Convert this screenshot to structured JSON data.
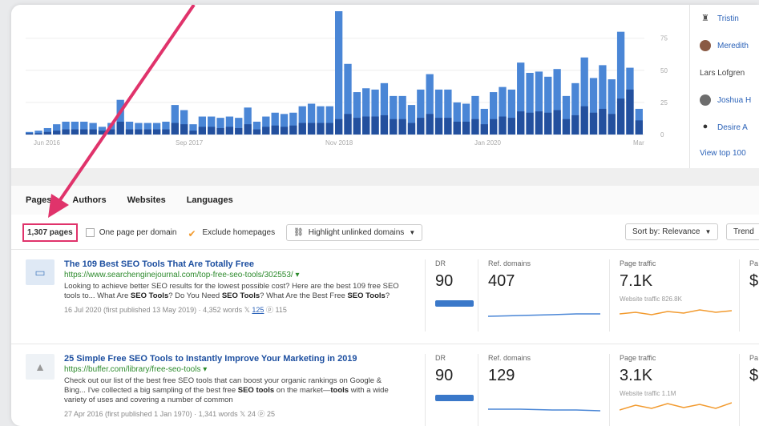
{
  "chart": {
    "x_ticks": [
      "Jun 2016",
      "Sep 2017",
      "Nov 2018",
      "Jan 2020",
      "Mar"
    ],
    "y_ticks": [
      "75",
      "50",
      "25",
      "0"
    ],
    "total": [
      2,
      3,
      5,
      8,
      10,
      10,
      10,
      9,
      6,
      9,
      27,
      10,
      9,
      9,
      9,
      10,
      23,
      19,
      8,
      14,
      14,
      13,
      14,
      13,
      21,
      10,
      14,
      17,
      16,
      17,
      22,
      24,
      22,
      22,
      96,
      55,
      33,
      36,
      35,
      40,
      30,
      30,
      23,
      35,
      47,
      35,
      35,
      25,
      24,
      30,
      20,
      33,
      37,
      35,
      56,
      48,
      49,
      45,
      51,
      30,
      40,
      60,
      44,
      54,
      43,
      80,
      52,
      20
    ],
    "dark": [
      1,
      1,
      2,
      3,
      4,
      4,
      4,
      4,
      3,
      4,
      10,
      4,
      4,
      4,
      4,
      4,
      9,
      8,
      3,
      6,
      6,
      5,
      6,
      5,
      8,
      4,
      6,
      7,
      6,
      7,
      9,
      9,
      9,
      9,
      12,
      16,
      13,
      14,
      14,
      15,
      12,
      12,
      9,
      13,
      16,
      13,
      13,
      10,
      10,
      12,
      8,
      12,
      14,
      13,
      18,
      17,
      18,
      17,
      19,
      12,
      15,
      22,
      17,
      20,
      16,
      28,
      35,
      11
    ],
    "colors": {
      "light": "#4a86d6",
      "dark": "#23509e"
    }
  },
  "authors": [
    {
      "name": "Tristin",
      "icon": "user-icon"
    },
    {
      "name": "Meredith",
      "icon": "avatar"
    },
    {
      "name": "Lars Lofgren",
      "icon": ""
    },
    {
      "name": "Joshua H",
      "icon": "avatar"
    },
    {
      "name": "Desire A",
      "icon": "user-icon"
    }
  ],
  "view_top": "View top 100",
  "tabs": [
    "Pages",
    "Authors",
    "Websites",
    "Languages"
  ],
  "toolbar": {
    "count": "1,307 pages",
    "one_per_domain": "One page per domain",
    "exclude_home": "Exclude homepages",
    "highlight": "Highlight unlinked domains",
    "sort": "Sort by: Relevance",
    "trend": "Trend"
  },
  "results": [
    {
      "title": "The 109 Best SEO Tools That Are Totally Free",
      "url": "https://www.searchenginejournal.com/top-free-seo-tools/302553/",
      "snippet_html": "Looking to achieve better SEO results for the lowest possible cost? Here are the best 109 free SEO tools to... What Are <b>SEO Tools</b>? Do You Need <b>SEO Tools</b>? What Are the Best Free <b>SEO Tools</b>?",
      "date": "16 Jul 2020 (first published 13 May 2019) · 4,352 words",
      "tw": "125",
      "pin": "115",
      "dr_label": "DR",
      "dr": "90",
      "rd_label": "Ref. domains",
      "rd": "407",
      "pt_label": "Page traffic",
      "pt": "7.1K",
      "wt": "Website traffic 826.8K",
      "pv_label": "Pa",
      "pv": "$"
    },
    {
      "title": "25 Simple Free SEO Tools to Instantly Improve Your Marketing in 2019",
      "url": "https://buffer.com/library/free-seo-tools",
      "snippet_html": "Check out our list of the best free SEO tools that can boost your organic rankings on Google &amp; Bing... I've collected a big sampling of the best free <b>SEO tools</b> on the market—<b>tools</b> with a wide variety of uses and covering a number of common",
      "date": "27 Apr 2016 (first published 1 Jan 1970) · 1,341 words",
      "tw": "24",
      "pin": "25",
      "dr_label": "DR",
      "dr": "90",
      "rd_label": "Ref. domains",
      "rd": "129",
      "pt_label": "Page traffic",
      "pt": "3.1K",
      "wt": "Website traffic 1.1M",
      "pv_label": "Pa",
      "pv": "$"
    }
  ]
}
